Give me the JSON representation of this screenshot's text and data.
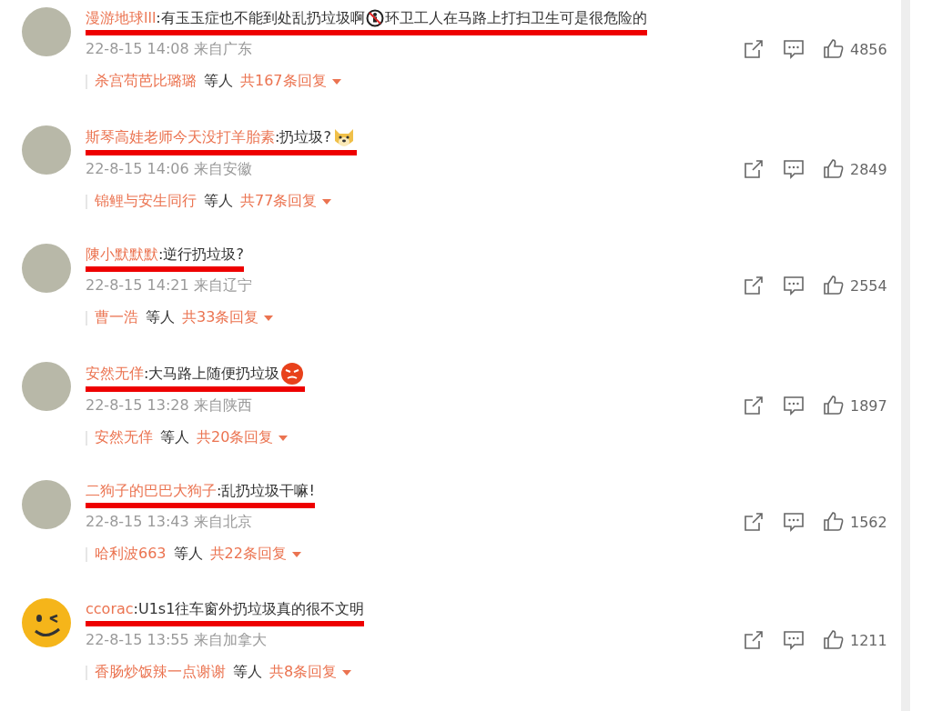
{
  "comments": [
    {
      "kind": "photo",
      "user": "漫游地球lll",
      "parts": [
        {
          "kind": "text",
          "text": ":有玉玉症也不能到处乱扔垃圾啊"
        },
        {
          "kind": "sign"
        },
        {
          "kind": "text",
          "text": "环卫工人在马路上打扫卫生可是很危险的"
        }
      ],
      "time": "22-8-15 14:08",
      "location": "来自广东",
      "likes": "4856",
      "reply_user": "杀宫苟芭比璐璐",
      "reply_suffix": "等人",
      "reply_count": "共167条回复"
    },
    {
      "kind": "photo",
      "user": "斯琴高娃老师今天没打羊胎素",
      "parts": [
        {
          "kind": "text",
          "text": ":扔垃圾?"
        },
        {
          "kind": "dog"
        }
      ],
      "time": "22-8-15 14:06",
      "location": "来自安徽",
      "likes": "2849",
      "reply_user": "锦鲤与安生同行",
      "reply_suffix": "等人",
      "reply_count": "共77条回复"
    },
    {
      "kind": "photo",
      "user": "陳小默默默",
      "parts": [
        {
          "kind": "text",
          "text": ":逆行扔垃圾?"
        }
      ],
      "time": "22-8-15 14:21",
      "location": "来自辽宁",
      "likes": "2554",
      "reply_user": "曹一浩",
      "reply_suffix": "等人",
      "reply_count": "共33条回复"
    },
    {
      "kind": "photo",
      "user": "安然无佯",
      "parts": [
        {
          "kind": "text",
          "text": ":大马路上随便扔垃圾"
        },
        {
          "kind": "angry"
        }
      ],
      "time": "22-8-15 13:28",
      "location": "来自陕西",
      "likes": "1897",
      "reply_user": "安然无佯",
      "reply_suffix": "等人",
      "reply_count": "共20条回复"
    },
    {
      "kind": "photo",
      "user": "二狗子的巴巴大狗子",
      "parts": [
        {
          "kind": "text",
          "text": ":乱扔垃圾干嘛!"
        }
      ],
      "time": "22-8-15 13:43",
      "location": "来自北京",
      "likes": "1562",
      "reply_user": "哈利波663",
      "reply_suffix": "等人",
      "reply_count": "共22条回复"
    },
    {
      "kind": "smiley",
      "user": "ccorac",
      "parts": [
        {
          "kind": "text",
          "text": ":U1s1往车窗外扔垃圾真的很不文明"
        }
      ],
      "time": "22-8-15 13:55",
      "location": "来自加拿大",
      "likes": "1211",
      "reply_user": "香肠炒饭辣一点谢谢",
      "reply_suffix": "等人",
      "reply_count": "共8条回复"
    }
  ]
}
